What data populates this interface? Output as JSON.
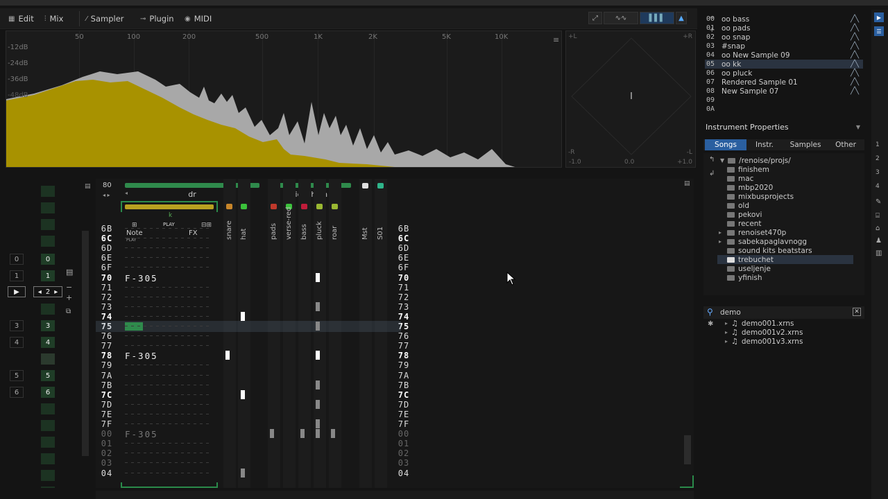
{
  "tabs": {
    "edit": "Edit",
    "mix": "Mix",
    "sampler": "Sampler",
    "plugin": "Plugin",
    "midi": "MIDI"
  },
  "spectrum": {
    "freq_labels": [
      "50",
      "100",
      "200",
      "500",
      "1K",
      "2K",
      "5K",
      "10K"
    ],
    "db_labels": [
      "-12dB",
      "-24dB",
      "-36dB",
      "-48dB"
    ],
    "colors": {
      "fill_left": "#a89200",
      "fill_right": "#a8a8a8"
    }
  },
  "scope": {
    "plus_l": "+L",
    "plus_r": "+R",
    "minus_r": "-R",
    "minus_l": "-L",
    "neg": "-1.0",
    "zero": "0.0",
    "pos": "+1.0"
  },
  "pattern": {
    "lines_per_beat": "80",
    "group_dr": "dr",
    "group_sidechain": "sidechain",
    "note_header": "Note",
    "fx_header": "FX",
    "play_label": "PLAY",
    "play_label2": "PLAY",
    "k_label": "k",
    "tracks": [
      "snare",
      "hat",
      "pads",
      "verse-red",
      "bass",
      "pluck",
      "roar",
      "Mst",
      "S01"
    ],
    "rows": [
      "6B",
      "6C",
      "6D",
      "6E",
      "6F",
      "70",
      "71",
      "72",
      "73",
      "74",
      "75",
      "76",
      "77",
      "78",
      "79",
      "7A",
      "7B",
      "7C",
      "7D",
      "7E",
      "7F",
      "00",
      "01",
      "02",
      "03",
      "04"
    ],
    "notes": {
      "70": "F-305",
      "78": "F-305",
      "00": "F-305"
    },
    "current_row": "75",
    "track_colors": [
      "#c8862a",
      "#3bc23b",
      "#c0392b",
      "#3bc23b",
      "#c01c3a",
      "#9ab832",
      "#9ab832",
      "#e0e0e0",
      "#2fb58a"
    ]
  },
  "left": {
    "seq_rows": [
      {
        "n": "0",
        "g": "0"
      },
      {
        "n": "1",
        "g": "1"
      },
      {
        "n": "",
        "g": "2"
      },
      {
        "n": "",
        "g": ""
      },
      {
        "n": "3",
        "g": "3"
      },
      {
        "n": "4",
        "g": "4"
      },
      {
        "n": "",
        "g": ""
      },
      {
        "n": "5",
        "g": "5"
      },
      {
        "n": "6",
        "g": "6"
      }
    ]
  },
  "instruments": [
    {
      "n": "00",
      "name": "oo bass"
    },
    {
      "n": "01",
      "name": "oo pads"
    },
    {
      "n": "02",
      "name": "oo snap"
    },
    {
      "n": "03",
      "name": "#snap"
    },
    {
      "n": "04",
      "name": "oo New Sample 09"
    },
    {
      "n": "05",
      "name": "oo kk"
    },
    {
      "n": "06",
      "name": "oo pluck"
    },
    {
      "n": "07",
      "name": "Rendered Sample 01"
    },
    {
      "n": "08",
      "name": "New Sample 07"
    },
    {
      "n": "09",
      "name": ""
    },
    {
      "n": "0A",
      "name": ""
    }
  ],
  "instrument_properties": "Instrument Properties",
  "browser_tabs": [
    "Songs",
    "Instr.",
    "Samples",
    "Other"
  ],
  "browser_root": "/renoise/projs/",
  "folders": [
    "finishem",
    "mac",
    "mbp2020",
    "mixbusprojects",
    "old",
    "pekovi",
    "recent",
    "renoiset470p",
    "sabekapaglavnogg",
    "sound kits beatstars",
    "trebuchet",
    "useljenje",
    "yfinish"
  ],
  "selected_folder": "trebuchet",
  "search_query": "demo",
  "files": [
    "demo001.xrns",
    "demo001v2.xrns",
    "demo001v3.xrns"
  ],
  "right_sidebar_nums": [
    "1",
    "2",
    "3",
    "4"
  ]
}
